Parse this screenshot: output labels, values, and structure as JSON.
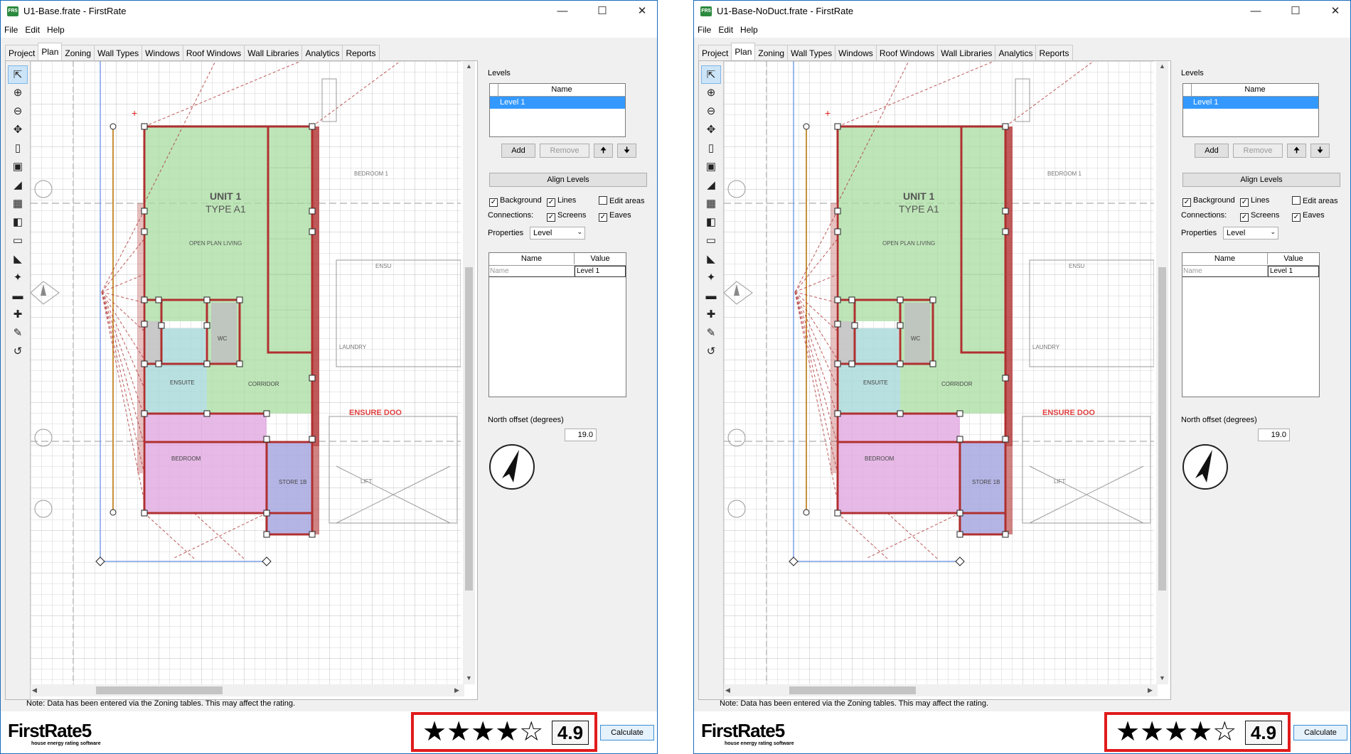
{
  "windows": [
    {
      "title": "U1-Base.frate - FirstRate",
      "menu": [
        "File",
        "Edit",
        "Help"
      ],
      "tabs": [
        "Project",
        "Plan",
        "Zoning",
        "Wall Types",
        "Windows",
        "Roof Windows",
        "Wall Libraries",
        "Analytics",
        "Reports"
      ],
      "active_tab": "Plan",
      "note": "Note: Data has been entered via the Zoning tables. This may affect the rating.",
      "side": {
        "levels_label": "Levels",
        "levels_header": "Name",
        "levels_rows": [
          "Level 1"
        ],
        "add_label": "Add",
        "remove_label": "Remove",
        "align_label": "Align Levels",
        "checkboxes": [
          {
            "label": "Background",
            "checked": true
          },
          {
            "label": "Lines",
            "checked": true
          },
          {
            "label": "Edit areas",
            "checked": false
          },
          {
            "label": "Screens",
            "checked": true
          },
          {
            "label": "Eaves",
            "checked": true
          }
        ],
        "connections_label": "Connections:",
        "properties_label": "Properties",
        "properties_value": "Level",
        "prop_headers": [
          "Name",
          "Value"
        ],
        "prop_row": [
          "Name",
          "Level 1"
        ],
        "north_label": "North offset (degrees)",
        "north_value": "19.0"
      },
      "plan_labels": {
        "unit": "UNIT 1",
        "type": "TYPE A1",
        "living": "OPEN PLAN LIVING",
        "wc": "WC",
        "ensuite": "ENSUITE",
        "corridor": "CORRIDOR",
        "bedroom": "BEDROOM",
        "store": "STORE 1B",
        "bedroom1": "BEDROOM 1",
        "laundry": "LAUNDRY",
        "ensure": "ENSURE DOO",
        "lift": "LIFT",
        "ens": "ENSU"
      },
      "logo": "FirstRate5",
      "tagline": "house energy rating software",
      "stars": "★★★★☆",
      "rating": "4.9",
      "calculate_label": "Calculate"
    },
    {
      "title": "U1-Base-NoDuct.frate - FirstRate",
      "menu": [
        "File",
        "Edit",
        "Help"
      ],
      "tabs": [
        "Project",
        "Plan",
        "Zoning",
        "Wall Types",
        "Windows",
        "Roof Windows",
        "Wall Libraries",
        "Analytics",
        "Reports"
      ],
      "active_tab": "Plan",
      "note": "Note: Data has been entered via the Zoning tables. This may affect the rating.",
      "side": {
        "levels_label": "Levels",
        "levels_header": "Name",
        "levels_rows": [
          "Level 1"
        ],
        "add_label": "Add",
        "remove_label": "Remove",
        "align_label": "Align Levels",
        "checkboxes": [
          {
            "label": "Background",
            "checked": true
          },
          {
            "label": "Lines",
            "checked": true
          },
          {
            "label": "Edit areas",
            "checked": false
          },
          {
            "label": "Screens",
            "checked": true
          },
          {
            "label": "Eaves",
            "checked": true
          }
        ],
        "connections_label": "Connections:",
        "properties_label": "Properties",
        "properties_value": "Level",
        "prop_headers": [
          "Name",
          "Value"
        ],
        "prop_row": [
          "Name",
          "Level 1"
        ],
        "north_label": "North offset (degrees)",
        "north_value": "19.0"
      },
      "plan_labels": {
        "unit": "UNIT 1",
        "type": "TYPE A1",
        "living": "OPEN PLAN LIVING",
        "wc": "WC",
        "ensuite": "ENSUITE",
        "corridor": "CORRIDOR",
        "bedroom": "BEDROOM",
        "store": "STORE 1B",
        "bedroom1": "BEDROOM 1",
        "laundry": "LAUNDRY",
        "ensure": "ENSURE DOO",
        "lift": "LIFT",
        "ens": "ENSU"
      },
      "logo": "FirstRate5",
      "tagline": "house energy rating software",
      "stars": "★★★★☆",
      "rating": "4.9",
      "calculate_label": "Calculate"
    }
  ],
  "colors": {
    "living_zone": "#a8dca0",
    "bedroom_zone": "#e0a8e0",
    "store_zone": "#a8a8e0",
    "ensuite_zone": "#a8d8d8",
    "wall": "#b03030",
    "rating_border": "#e01b1b"
  },
  "icons": [
    "select-arrow-icon",
    "zoom-in-icon",
    "zoom-out-icon",
    "pan-icon",
    "draw-wall-icon",
    "draw-zone-icon",
    "roof-icon",
    "window-icon",
    "door-icon",
    "door-open-icon",
    "eave-icon",
    "polygon-icon",
    "dimension-icon",
    "point-icon",
    "eraser-icon",
    "undo-icon",
    "compass-icon"
  ]
}
